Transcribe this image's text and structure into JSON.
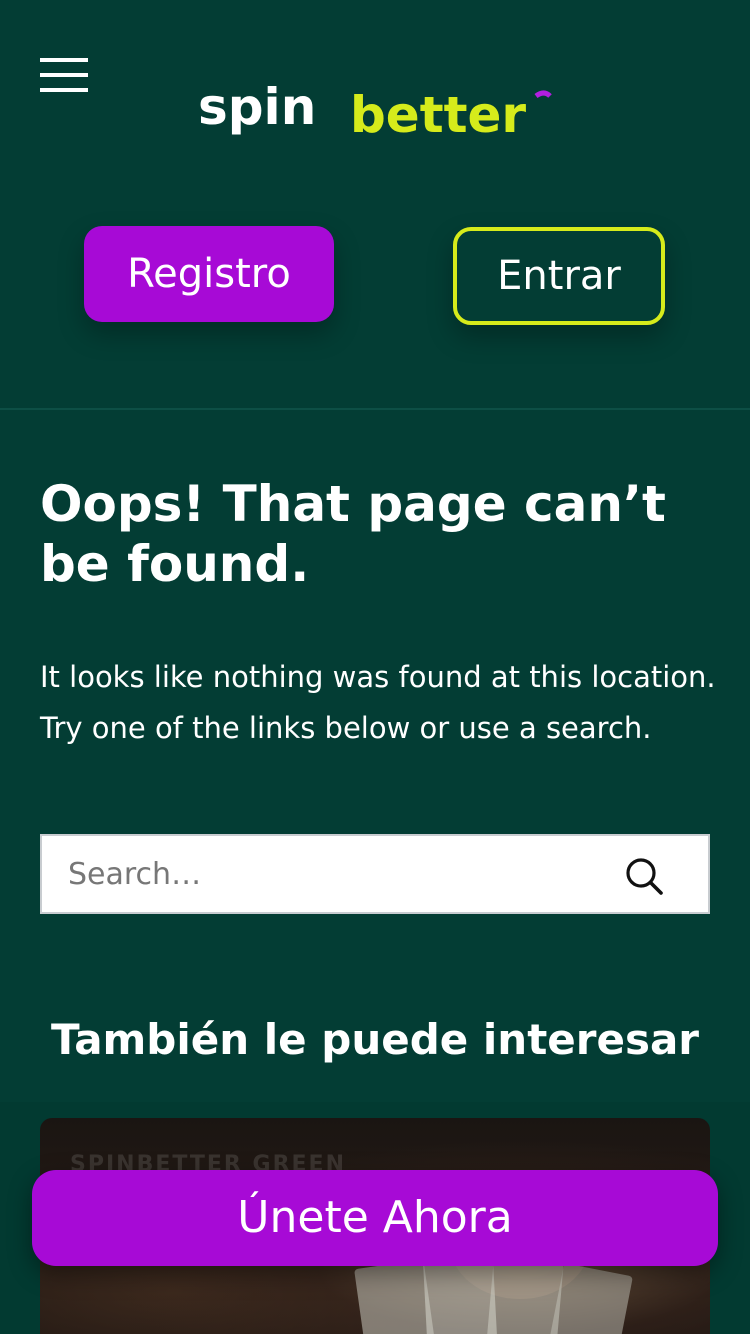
{
  "header": {
    "logo_text_1": "spin",
    "logo_text_2": "better",
    "register_label": "Registro",
    "login_label": "Entrar"
  },
  "main": {
    "title": "Oops! That page can’t be found.",
    "message": "It looks like nothing was found at this location. Try one of the links below or use a search.",
    "search": {
      "placeholder": "Search…",
      "value": ""
    },
    "related_heading": "También le puede interesar",
    "card_caption": "SPINBETTER GREEN"
  },
  "cta": {
    "join_label": "Únete Ahora"
  },
  "colors": {
    "background": "#033d34",
    "accent_purple": "#a70ad6",
    "accent_lime": "#d6eb1b"
  },
  "icons": {
    "menu": "hamburger-menu-icon",
    "search": "search-icon"
  }
}
